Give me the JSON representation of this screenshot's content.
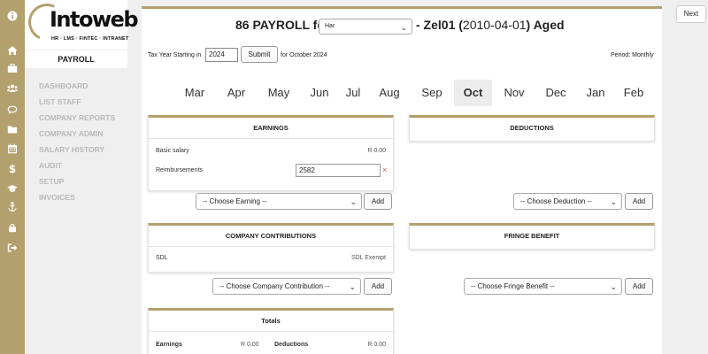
{
  "iconbar": {
    "items": [
      {
        "icon": "info-icon"
      },
      {
        "icon": "home-icon"
      },
      {
        "icon": "briefcase-icon"
      },
      {
        "icon": "users-icon"
      },
      {
        "icon": "comment-icon"
      },
      {
        "icon": "folder-icon"
      },
      {
        "icon": "calendar-icon"
      },
      {
        "icon": "dollar-icon"
      },
      {
        "icon": "graduation-cap-icon"
      },
      {
        "icon": "anchor-icon"
      },
      {
        "icon": "lock-icon"
      },
      {
        "icon": "sign-out-icon"
      }
    ],
    "color": "#b3a06c"
  },
  "logo": {
    "name": "Intoweb",
    "tagline": "HR · LMS · FINTEC · INTRANET"
  },
  "sidebar": {
    "title": "PAYROLL",
    "items": [
      {
        "label": "DASHBOARD"
      },
      {
        "label": "LIST STAFF"
      },
      {
        "label": "COMPANY REPORTS"
      },
      {
        "label": "COMPANY ADMIN"
      },
      {
        "label": "SALARY HISTORY"
      },
      {
        "label": "AUDIT"
      },
      {
        "label": "SETUP"
      },
      {
        "label": "INVOICES"
      }
    ]
  },
  "header": {
    "prefix": "86 PAYROLL for",
    "employee_selected": "Har",
    "code": "- Zel01 (",
    "date": "2010-04-01",
    "suffix": ") Aged"
  },
  "tax": {
    "label": "Tax Year Starting in",
    "year": "2024",
    "submit_label": "Submit",
    "for_label": "for October 2024",
    "period": "Period: Monthly"
  },
  "months": {
    "items": [
      "Mar",
      "Apr",
      "May",
      "Jun",
      "Jul",
      "Aug",
      "Sep",
      "Oct",
      "Nov",
      "Dec",
      "Jan",
      "Feb"
    ],
    "active": "Oct"
  },
  "earnings": {
    "title": "EARNINGS",
    "basic_label": "Basic salary",
    "basic_value": "R 0.00",
    "reimb_label": "Reimbursements",
    "reimb_value": "2582",
    "remove_symbol": "×",
    "choose": "-- Choose Earning --",
    "add_label": "Add"
  },
  "deductions": {
    "title": "DEDUCTIONS",
    "choose": "-- Choose Deduction --",
    "add_label": "Add"
  },
  "contributions": {
    "title": "COMPANY CONTRIBUTIONS",
    "sdl_label": "SDL",
    "sdl_value": "SDL Exempt",
    "choose": "-- Choose Company Contribution --",
    "add_label": "Add"
  },
  "fringe": {
    "title": "FRINGE BENEFIT",
    "choose": "-- Choose Fringe Benefit --",
    "add_label": "Add"
  },
  "totals": {
    "title": "Totals",
    "earnings_label": "Earnings",
    "earnings_value": "R 0.00",
    "deductions_label": "Deductions",
    "deductions_value": "R 0.00"
  },
  "nav": {
    "next_label": "Next"
  }
}
